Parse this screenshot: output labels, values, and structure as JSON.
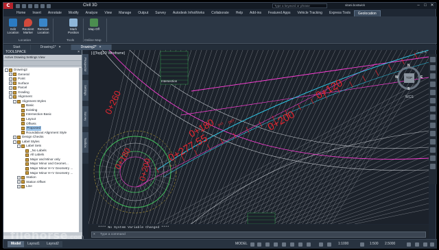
{
  "app": {
    "title": "Civil 3D",
    "search_placeholder": "Type a keyword or phrase",
    "user": "sitani.bostwick"
  },
  "ribbon_tabs": [
    "Home",
    "Insert",
    "Annotate",
    "Modify",
    "Analyze",
    "View",
    "Manage",
    "Output",
    "Survey",
    "Autodesk InfraWorks",
    "Collaborate",
    "Help",
    "Add-ins",
    "Featured Apps",
    "Vehicle Tracking",
    "Express Tools",
    "Geolocation"
  ],
  "ribbon": {
    "buttons": [
      {
        "label": "Edit Location"
      },
      {
        "label": "Reorient Marker"
      },
      {
        "label": "Remove Location"
      },
      {
        "label": "Mark Position"
      },
      {
        "label": "Map Off"
      }
    ],
    "groups": [
      "Location",
      "Tools",
      "Online Map"
    ]
  },
  "doc_tabs": [
    {
      "label": "Start"
    },
    {
      "label": "Drawing1*"
    },
    {
      "label": "Drawing2*"
    }
  ],
  "toolspace": {
    "title": "TOOLSPACE",
    "dropdown": "Active Drawing Settings View",
    "tree": [
      {
        "label": "Drawing2",
        "depth": 0,
        "exp": "-"
      },
      {
        "label": "General",
        "depth": 1,
        "exp": "+"
      },
      {
        "label": "Point",
        "depth": 1,
        "exp": "+"
      },
      {
        "label": "Surface",
        "depth": 1,
        "exp": "+"
      },
      {
        "label": "Parcel",
        "depth": 1,
        "exp": "+"
      },
      {
        "label": "Grading",
        "depth": 1,
        "exp": "+"
      },
      {
        "label": "Alignment",
        "depth": 1,
        "exp": "-"
      },
      {
        "label": "Alignment Styles",
        "depth": 2,
        "exp": "-"
      },
      {
        "label": "Basic",
        "depth": 3,
        "exp": ""
      },
      {
        "label": "Existing",
        "depth": 3,
        "exp": ""
      },
      {
        "label": "Intersection Basic",
        "depth": 3,
        "exp": ""
      },
      {
        "label": "Layout",
        "depth": 3,
        "exp": ""
      },
      {
        "label": "Offsets",
        "depth": 3,
        "exp": ""
      },
      {
        "label": "Proposed",
        "depth": 3,
        "exp": "",
        "selected": true
      },
      {
        "label": "Roundabout Alignment Style",
        "depth": 3,
        "exp": ""
      },
      {
        "label": "Design Checks",
        "depth": 2,
        "exp": "+"
      },
      {
        "label": "Label Styles",
        "depth": 2,
        "exp": "-"
      },
      {
        "label": "Label Sets",
        "depth": 3,
        "exp": "-"
      },
      {
        "label": "_No Labels",
        "depth": 4,
        "exp": ""
      },
      {
        "label": "All Labels",
        "depth": 4,
        "exp": ""
      },
      {
        "label": "Major and Minor only",
        "depth": 4,
        "exp": ""
      },
      {
        "label": "Major Minor and Geomet...",
        "depth": 4,
        "exp": ""
      },
      {
        "label": "Major Minor H+V Geometry ...",
        "depth": 4,
        "exp": ""
      },
      {
        "label": "Major Minor H+V Geometry ...",
        "depth": 4,
        "exp": ""
      },
      {
        "label": "Station",
        "depth": 3,
        "exp": "+"
      },
      {
        "label": "Station Offset",
        "depth": 3,
        "exp": "+"
      },
      {
        "label": "Line",
        "depth": 3,
        "exp": "+"
      }
    ],
    "side_tabs": [
      "Prospector",
      "Settings",
      "Survey",
      "Toolbox"
    ]
  },
  "viewport": {
    "label": "[-][Top][2D Wireframe]",
    "viewcube": {
      "top": "TOP",
      "n": "N",
      "s": "S",
      "e": "E",
      "w": "W"
    },
    "wcs": "WCS",
    "station_labels": [
      "0+120",
      "0+200",
      "0+180",
      "0+277.55",
      "0+260",
      "0+180",
      "0+200"
    ],
    "small_labels": [
      "PVI",
      "DEF",
      "Intersection"
    ]
  },
  "command": {
    "history": "**** No System Variable Changed ****",
    "placeholder": "Type a command"
  },
  "status": {
    "layout_tabs": [
      "Model",
      "Layout1",
      "Layout2"
    ],
    "mode": "MODEL",
    "scale": "1:1000",
    "annoscale": "1:500",
    "value": "2.5000"
  },
  "watermark": {
    "main": "filehorse",
    "suffix": ".com"
  },
  "colors": {
    "road_red": "#e3262f",
    "magenta": "#ff3fd8",
    "cyan": "#30c8e8",
    "green_circle": "#3fbf5a",
    "grid_white": "#c8ccd2"
  }
}
